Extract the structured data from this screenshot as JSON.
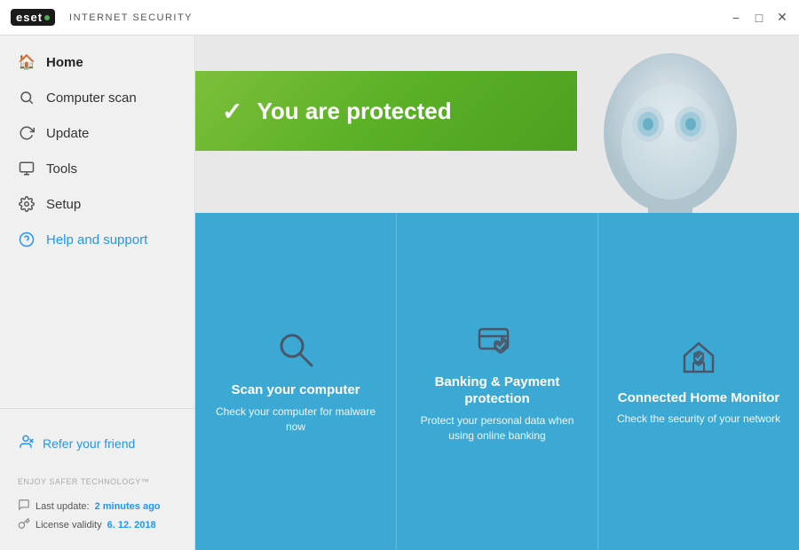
{
  "titlebar": {
    "app_name": "INTERNET SECURITY",
    "logo_text": "eset",
    "minimize_label": "−",
    "maximize_label": "□",
    "close_label": "✕"
  },
  "sidebar": {
    "items": [
      {
        "id": "home",
        "label": "Home",
        "icon": "🏠",
        "active": true
      },
      {
        "id": "scan",
        "label": "Computer scan",
        "icon": "🔍",
        "active": false
      },
      {
        "id": "update",
        "label": "Update",
        "icon": "🔄",
        "active": false
      },
      {
        "id": "tools",
        "label": "Tools",
        "icon": "🧰",
        "active": false
      },
      {
        "id": "setup",
        "label": "Setup",
        "icon": "⚙️",
        "active": false
      },
      {
        "id": "help",
        "label": "Help and support",
        "icon": "❓",
        "active": false,
        "style": "blue"
      }
    ],
    "refer": {
      "icon": "👤",
      "label": "Refer your friend"
    },
    "enjoy_text": "ENJOY SAFER TECHNOLOGY™",
    "footer": {
      "last_update_label": "Last update:",
      "last_update_value": "2 minutes ago",
      "license_label": "License validity",
      "license_value": "6. 12. 2018"
    }
  },
  "main": {
    "protected_text": "You are protected",
    "check_mark": "✓"
  },
  "feature_cards": [
    {
      "id": "scan-computer",
      "title": "Scan your computer",
      "desc": "Check your computer for malware now",
      "icon_type": "magnifier"
    },
    {
      "id": "banking",
      "title": "Banking & Payment protection",
      "desc": "Protect your personal data when using online banking",
      "icon_type": "card-shield"
    },
    {
      "id": "home-monitor",
      "title": "Connected Home Monitor",
      "desc": "Check the security of your network",
      "icon_type": "home-shield"
    }
  ]
}
